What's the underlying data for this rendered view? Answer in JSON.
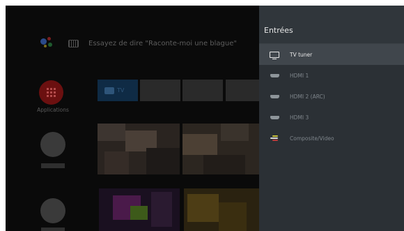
{
  "home": {
    "assistant_hint": "Essayez de dire \"Raconte-moi une blague\"",
    "apps_label": "Applications",
    "tv_tile_label": "TV"
  },
  "inputs_panel": {
    "title": "Entrées",
    "items": [
      {
        "label": "TV tuner",
        "icon": "tv-icon",
        "selected": true
      },
      {
        "label": "HDMI 1",
        "icon": "hdmi-icon",
        "selected": false
      },
      {
        "label": "HDMI 2 (ARC)",
        "icon": "hdmi-icon",
        "selected": false
      },
      {
        "label": "HDMI 3",
        "icon": "hdmi-icon",
        "selected": false
      },
      {
        "label": "Composite/Video",
        "icon": "composite-icon",
        "selected": false
      }
    ]
  },
  "colors": {
    "panel_bg": "#2b3035",
    "selected_bg": "#40464c",
    "apps_red": "#6b1010",
    "tv_tile_blue": "#0f2b45"
  }
}
